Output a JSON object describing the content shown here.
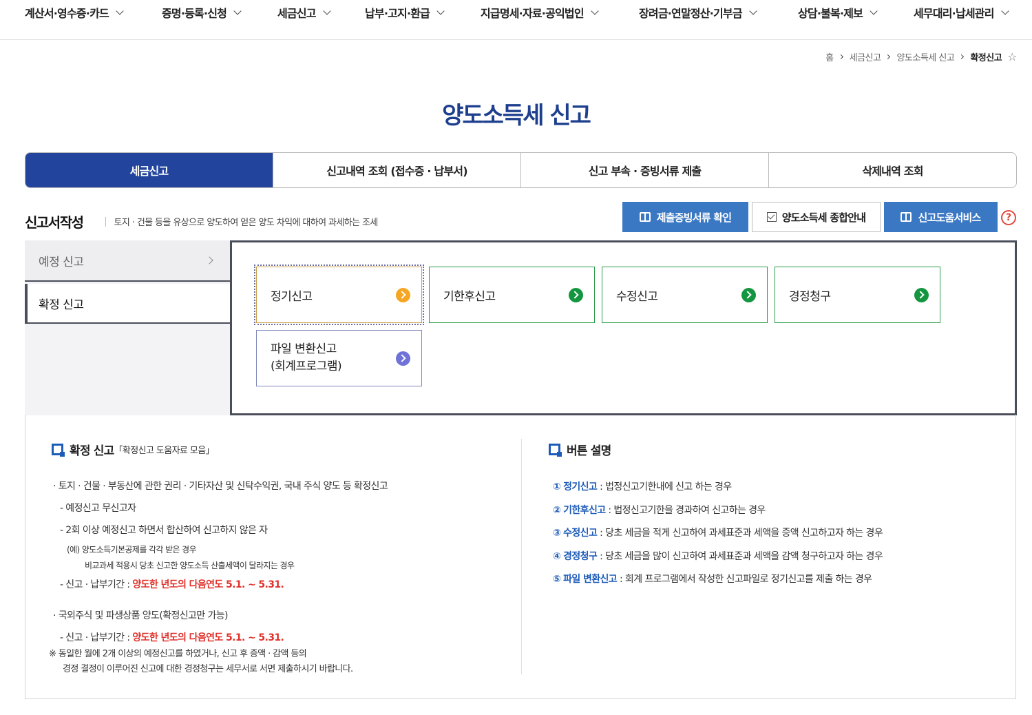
{
  "topnav": [
    "계산서·영수증·카드",
    "증명·등록·신청",
    "세금신고",
    "납부·고지·환급",
    "지급명세·자료·공익법인",
    "장려금·연말정산·기부금",
    "상담·불복·제보",
    "세무대리·납세관리"
  ],
  "breadcrumb": {
    "home": "홈",
    "level1": "세금신고",
    "level2": "양도소득세 신고",
    "current": "확정신고"
  },
  "page_title": "양도소득세 신고",
  "tabs": [
    "세금신고",
    "신고내역 조회 (접수증 · 납부서)",
    "신고 부속 · 증빙서류 제출",
    "삭제내역 조회"
  ],
  "section": {
    "title": "신고서작성",
    "desc": "토지 · 건물 등을 유상으로 양도하여 얻은 양도 차익에 대하여 과세하는 조세"
  },
  "tools": {
    "evidence": "제출증빙서류 확인",
    "guide": "양도소득세 종합안내",
    "help_service": "신고도움서비스",
    "help_icon": "?"
  },
  "sidebar": {
    "item1": "예정 신고",
    "item2": "확정 신고"
  },
  "cards": {
    "regular": "정기신고",
    "late": "기한후신고",
    "amend": "수정신고",
    "claim": "경정청구",
    "file_line1": "파일 변환신고",
    "file_line2": "(회계프로그램)"
  },
  "info_left": {
    "title": "확정 신고",
    "sub": "「확정신고 도움자료 모음」",
    "l1": "· 토지 · 건물 · 부동산에 관한 권리 · 기타자산 및 신탁수익권, 국내 주식 양도 등 확정신고",
    "l2": "- 예정신고 무신고자",
    "l3": "- 2회 이상 예정신고 하면서 합산하여 신고하지 않은 자",
    "l4": "(예) 양도소득기본공제를 각각 받은 경우",
    "l5": "비교과세 적용시 당초 신고한 양도소득 산출세액이 달라지는 경우",
    "l6_pre": "- 신고 · 납부기간 : ",
    "l6_red": "양도한 년도의 다음연도 5.1. ~ 5.31.",
    "l7": "· 국외주식 및 파생상품 양도(확정신고만 가능)",
    "l8_pre": "- 신고 · 납부기간 : ",
    "l8_red": "양도한 년도의 다음연도 5.1. ~ 5.31.",
    "l9": "※ 동일한 월에 2개 이상의 예정신고를 하였거나, 신고 후 증액 · 감액 등의",
    "l10": "경정 결정이 이루어진 신고에 대한 경정청구는 세무서로 서면 제출하시기 바랍니다."
  },
  "info_right": {
    "title": "버튼 설명",
    "items": [
      {
        "num": "①",
        "name": "정기신고",
        "desc": " : 법정신고기한내에 신고 하는 경우"
      },
      {
        "num": "②",
        "name": "기한후신고",
        "desc": " : 법정신고기한을 경과하여 신고하는 경우"
      },
      {
        "num": "③",
        "name": "수정신고",
        "desc": " : 당초 세금을 적게 신고하여 과세표준과 세액을 증액 신고하고자 하는 경우"
      },
      {
        "num": "④",
        "name": "경정청구",
        "desc": " : 당초 세금을 많이 신고하여 과세표준과 세액을 감액 청구하고자 하는 경우"
      },
      {
        "num": "⑤",
        "name": "파일 변환신고",
        "desc": " : 회계 프로그램에서 작성한 신고파일로 정기신고를  제출 하는 경우"
      }
    ]
  },
  "colors": {
    "primary": "#22449c",
    "title": "#1d3f8e",
    "tool_blue": "#3a78c4",
    "green": "#14953f",
    "orange": "#f5a623",
    "red": "#e0302a"
  }
}
